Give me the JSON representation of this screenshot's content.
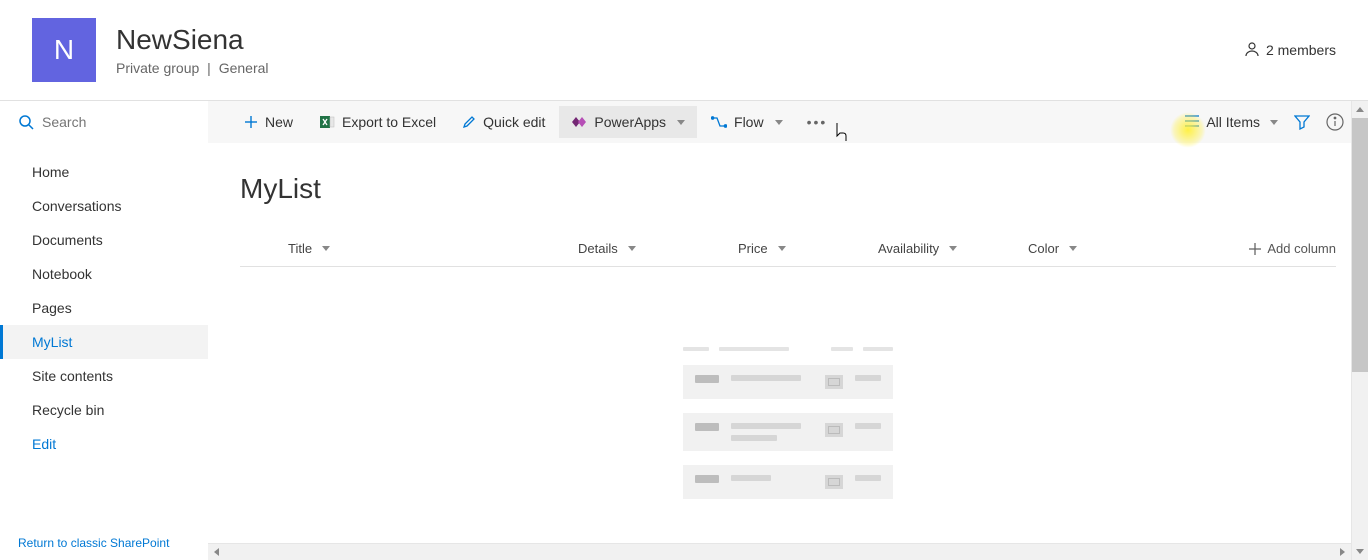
{
  "header": {
    "site_initial": "N",
    "site_title": "NewSiena",
    "privacy": "Private group",
    "classification": "General",
    "members_label": "2 members"
  },
  "search": {
    "placeholder": "Search"
  },
  "sidebar": {
    "items": [
      {
        "label": "Home"
      },
      {
        "label": "Conversations"
      },
      {
        "label": "Documents"
      },
      {
        "label": "Notebook"
      },
      {
        "label": "Pages"
      },
      {
        "label": "MyList",
        "selected": true
      },
      {
        "label": "Site contents"
      },
      {
        "label": "Recycle bin"
      }
    ],
    "edit_label": "Edit",
    "classic_label": "Return to classic SharePoint"
  },
  "toolbar": {
    "new_label": "New",
    "export_label": "Export to Excel",
    "quick_edit_label": "Quick edit",
    "powerapps_label": "PowerApps",
    "flow_label": "Flow",
    "all_items_label": "All Items"
  },
  "list": {
    "title": "MyList",
    "columns": [
      {
        "label": "Title"
      },
      {
        "label": "Details"
      },
      {
        "label": "Price"
      },
      {
        "label": "Availability"
      },
      {
        "label": "Color"
      }
    ],
    "add_column_label": "Add column"
  }
}
